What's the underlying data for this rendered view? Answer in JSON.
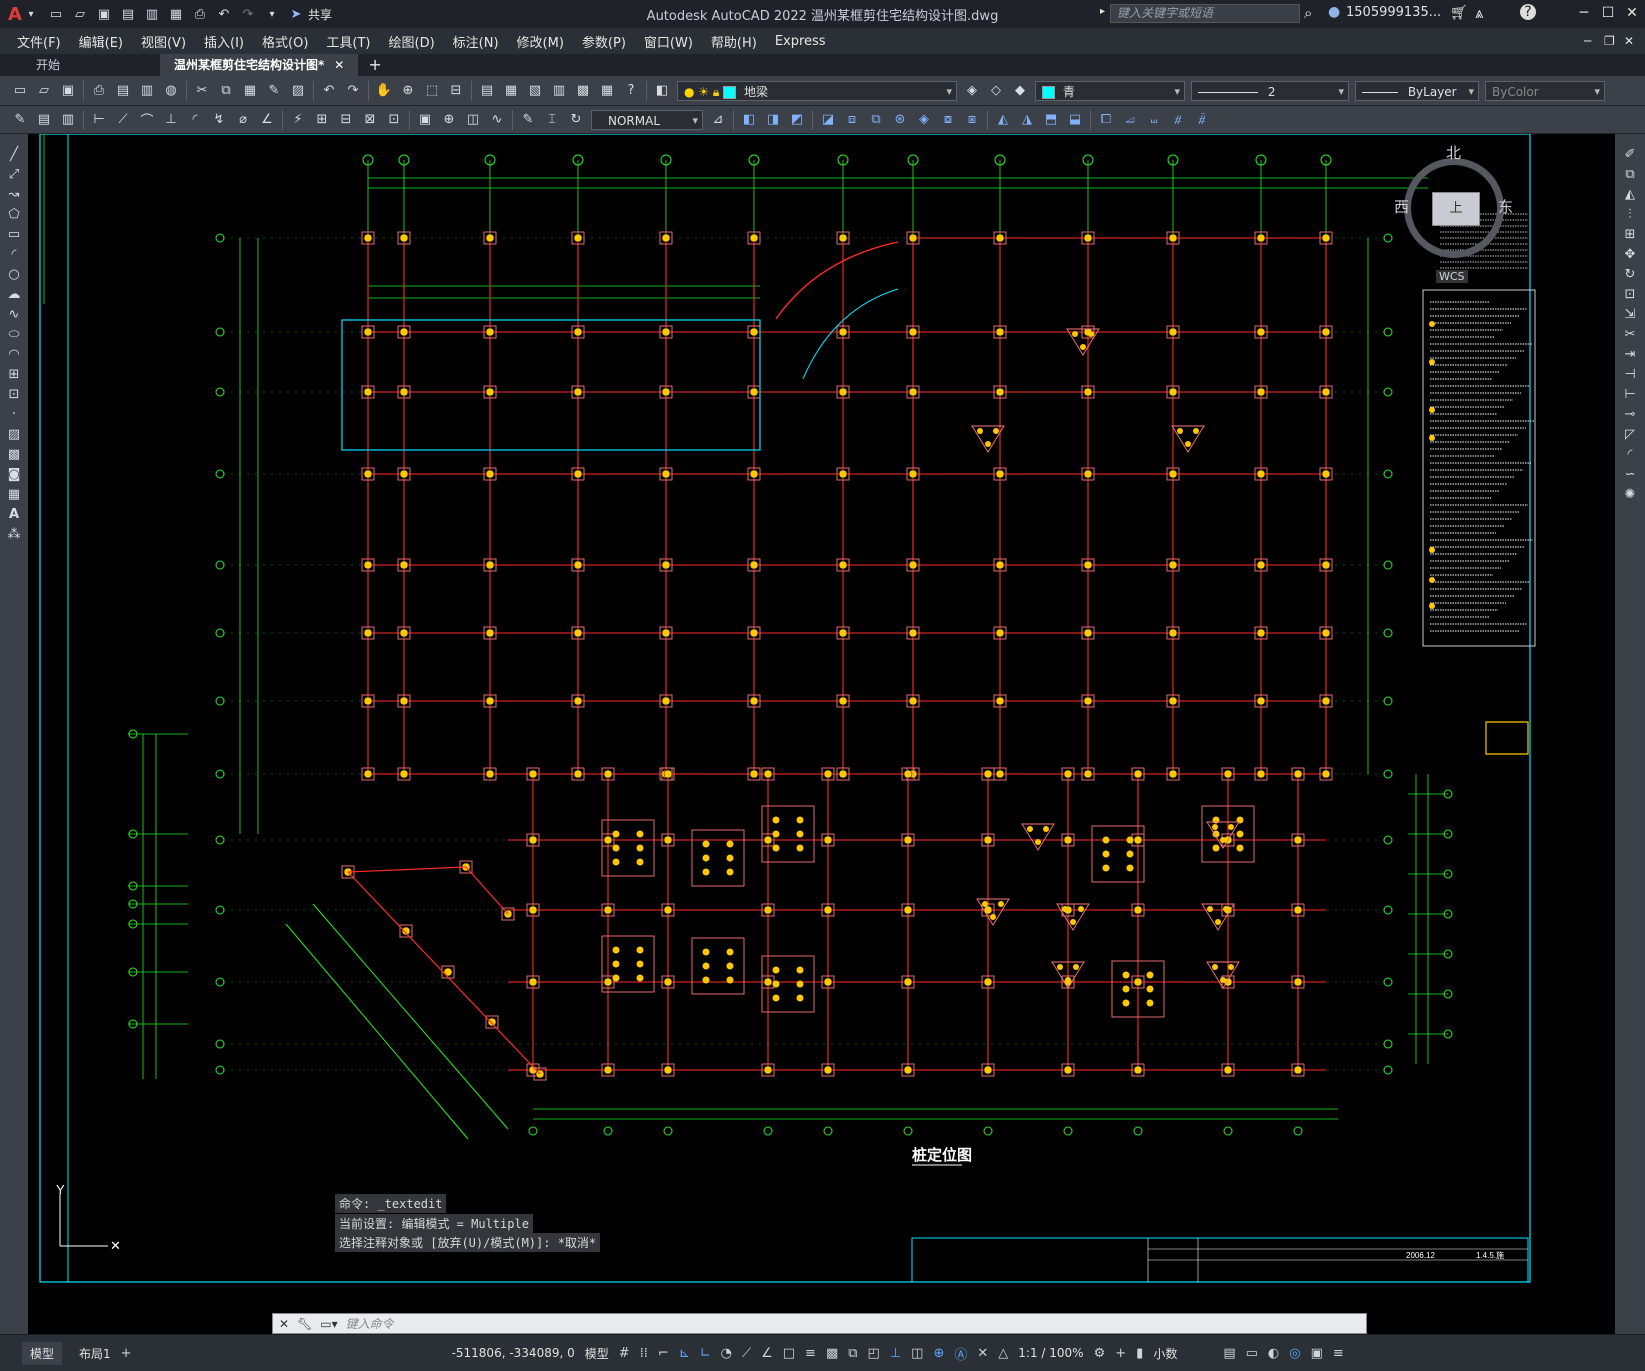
{
  "app": {
    "title": "Autodesk AutoCAD 2022    温州某框剪住宅结构设计图.dwg",
    "logo": "A",
    "share_label": "共享",
    "search_placeholder": "键入关键字或短语",
    "user": "1505999135..."
  },
  "menu": [
    "文件(F)",
    "编辑(E)",
    "视图(V)",
    "插入(I)",
    "格式(O)",
    "工具(T)",
    "绘图(D)",
    "标注(N)",
    "修改(M)",
    "参数(P)",
    "窗口(W)",
    "帮助(H)",
    "Express"
  ],
  "tabs": [
    {
      "label": "开始"
    },
    {
      "label": "温州某框剪住宅结构设计图*"
    }
  ],
  "toolbar": {
    "layer": "地梁",
    "color": "青",
    "linetype_scale": "2",
    "lineweight": "ByLayer",
    "plotstyle": "ByColor",
    "textstyle": "NORMAL",
    "layer_color": "#00ffff",
    "color_swatch": "#00ffff"
  },
  "viewcube": {
    "north": "北",
    "west": "西",
    "east": "东",
    "top": "上",
    "wcs": "WCS"
  },
  "drawing": {
    "title": "桩定位图",
    "accent_red": "#ff2a2a",
    "accent_green": "#22ee22",
    "accent_cyan": "#00e5ff",
    "pile_yellow": "#ffc800"
  },
  "command": {
    "lines": [
      "命令: _textedit",
      "当前设置: 编辑模式 = Multiple",
      "选择注释对象或 [放弃(U)/模式(M)]: *取消*"
    ],
    "placeholder": "键入命令"
  },
  "status": {
    "layout_tabs": [
      "模型",
      "布局1"
    ],
    "coords": "-511806, -334089, 0",
    "model": "模型",
    "scale": "1:1 / 100%",
    "units": "小数"
  },
  "title_block": {
    "date": "2006.12",
    "sheet": "1.4.5.施"
  }
}
